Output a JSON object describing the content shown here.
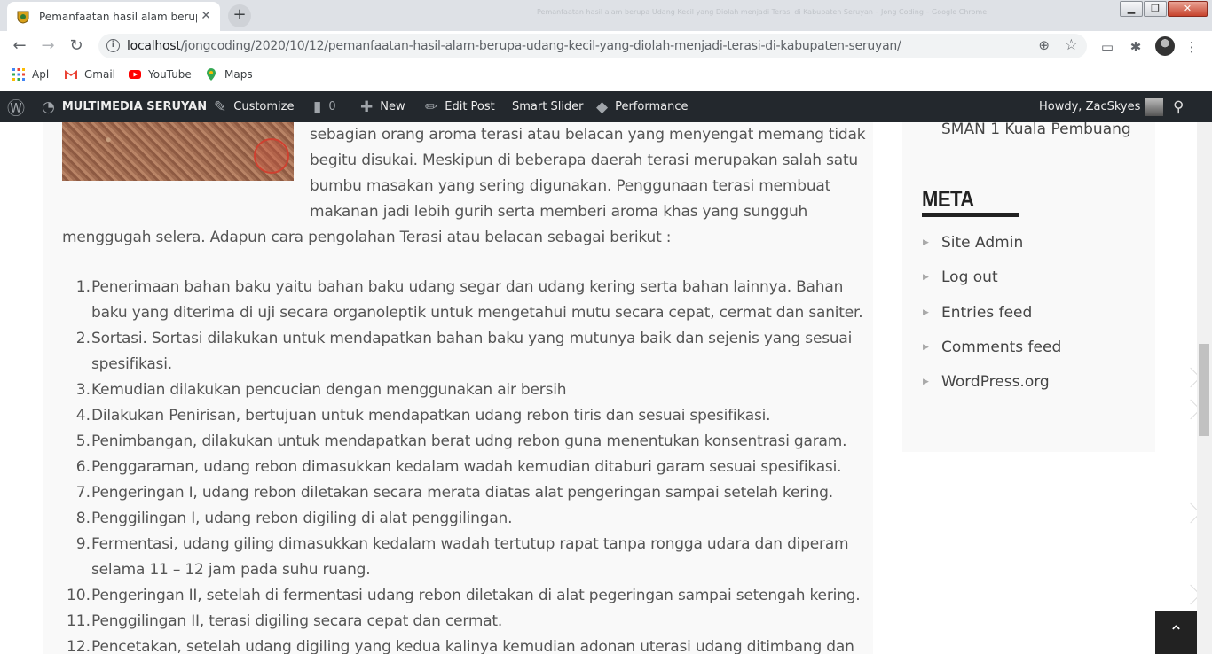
{
  "browser": {
    "tab_title": "Pemanfaatan hasil alam berupa Udang Kecil yang Diolah menjadi Terasi di Kabupaten Seruyan",
    "window_title": "Pemanfaatan hasil alam berupa Udang Kecil yang Diolah menjadi Terasi di Kabupaten Seruyan – Jong Coding – Google Chrome",
    "new_tab": "+",
    "close_tab": "✕",
    "url_host": "localhost",
    "url_path": "/jongcoding/2020/10/12/pemanfaatan-hasil-alam-berupa-udang-kecil-yang-diolah-menjadi-terasi-di-kabupaten-seruyan/",
    "bookmarks": [
      {
        "label": "Apl",
        "icon": "apps-grid-icon"
      },
      {
        "label": "Gmail",
        "icon": "gmail-icon"
      },
      {
        "label": "YouTube",
        "icon": "youtube-icon"
      },
      {
        "label": "Maps",
        "icon": "maps-pin-icon"
      }
    ]
  },
  "adminbar": {
    "site_name": "MULTIMEDIA SERUYAN",
    "customize": "Customize",
    "comments_count": "0",
    "new": "New",
    "edit_post": "Edit Post",
    "smart_slider": "Smart Slider",
    "performance": "Performance",
    "howdy": "Howdy, ZacSkyes"
  },
  "article": {
    "intro_lines": [
      "sebagian orang aroma terasi atau belacan yang menyengat memang tidak",
      "begitu disukai. Meskipun di beberapa daerah terasi merupakan salah satu",
      "bumbu masakan yang sering digunakan. Penggunaan terasi membuat",
      "makanan jadi lebih gurih serta memberi aroma khas yang sungguh",
      "menggugah selera. Adapun cara pengolahan Terasi atau belacan sebagai berikut :"
    ],
    "steps": [
      {
        "num": "1.",
        "lines": [
          "Penerimaan bahan baku yaitu bahan baku udang segar dan udang kering serta bahan lainnya. Bahan",
          "baku yang diterima di uji secara organoleptik untuk mengetahui mutu secara cepat, cermat dan saniter."
        ]
      },
      {
        "num": "2.",
        "lines": [
          "Sortasi. Sortasi dilakukan untuk mendapatkan bahan baku yang mutunya baik dan sejenis yang sesuai",
          "spesifikasi."
        ]
      },
      {
        "num": "3.",
        "lines": [
          "Kemudian dilakukan pencucian dengan menggunakan air bersih"
        ]
      },
      {
        "num": "4.",
        "lines": [
          "Dilakukan Penirisan, bertujuan untuk mendapatkan udang rebon tiris dan sesuai spesifikasi."
        ]
      },
      {
        "num": "5.",
        "lines": [
          "Penimbangan, dilakukan untuk mendapatkan berat udng rebon guna menentukan konsentrasi garam."
        ]
      },
      {
        "num": "6.",
        "lines": [
          "Penggaraman, udang rebon dimasukkan kedalam wadah kemudian ditaburi garam sesuai spesifikasi."
        ]
      },
      {
        "num": "7.",
        "lines": [
          "Pengeringan I, udang rebon diletakan secara merata diatas alat pengeringan sampai setelah kering."
        ]
      },
      {
        "num": "8.",
        "lines": [
          "Penggilingan I,  udang rebon digiling di alat penggilingan."
        ]
      },
      {
        "num": "9.",
        "lines": [
          "Fermentasi, udang giling dimasukkan kedalam wadah tertutup rapat tanpa rongga udara dan diperam",
          "selama 11 – 12 jam pada suhu ruang."
        ]
      },
      {
        "num": "10.",
        "lines": [
          "Pengeringan II, setelah di fermentasi udang rebon diletakan di alat pegeringan sampai setengah kering."
        ]
      },
      {
        "num": "11.",
        "lines": [
          "Penggilingan II, terasi digiling secara cepat dan cermat."
        ]
      },
      {
        "num": "12.",
        "lines": [
          "Pencetakan, setelah udang digiling yang kedua kalinya kemudian adonan uterasi udang ditimbang dan"
        ]
      }
    ]
  },
  "sidebar": {
    "top_item": "SMAN 1 Kuala Pembuang",
    "meta_title": "META",
    "meta_links": [
      "Site Admin",
      "Log out",
      "Entries feed",
      "Comments feed",
      "WordPress.org"
    ]
  },
  "colors": {
    "adminbar_bg": "#23282d",
    "content_bg": "#f9f9f9",
    "text": "#555555"
  }
}
